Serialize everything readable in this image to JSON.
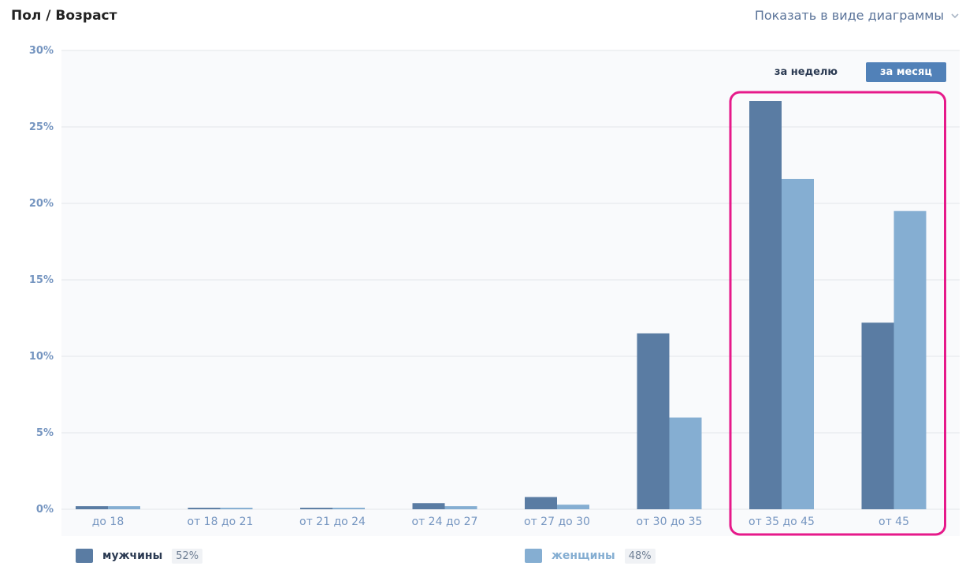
{
  "header": {
    "title": "Пол / Возраст",
    "view_toggle_label": "Показать в виде диаграммы"
  },
  "period_buttons": {
    "week_label": "за неделю",
    "month_label": "за месяц",
    "active": "month"
  },
  "legend": {
    "men": {
      "label": "мужчины",
      "percent": "52%",
      "color": "#5a7ca3"
    },
    "women": {
      "label": "женщины",
      "percent": "48%",
      "color": "#85aed2"
    }
  },
  "colors": {
    "accent": "#5181b8",
    "axis_label": "#7595c0",
    "gridline": "#e2e5ea",
    "plot_background": "#f9fafc",
    "highlight": "#e6198a"
  },
  "chart_data": {
    "type": "bar",
    "categories": [
      "до 18",
      "от 18 до 21",
      "от 21 до 24",
      "от 24 до 27",
      "от 27 до 30",
      "от 30 до 35",
      "от 35 до 45",
      "от 45"
    ],
    "series": [
      {
        "name": "мужчины",
        "values": [
          0.2,
          0.1,
          0.1,
          0.4,
          0.8,
          11.5,
          26.7,
          12.2
        ]
      },
      {
        "name": "женщины",
        "values": [
          0.2,
          0.1,
          0.1,
          0.2,
          0.3,
          6.0,
          21.6,
          19.5
        ]
      }
    ],
    "y_ticks": [
      "0%",
      "5%",
      "10%",
      "15%",
      "20%",
      "25%",
      "30%"
    ],
    "ylim": [
      0,
      30
    ],
    "grid": true,
    "legend_position": "bottom",
    "highlighted_categories": [
      "от 35 до 45",
      "от 45"
    ]
  }
}
